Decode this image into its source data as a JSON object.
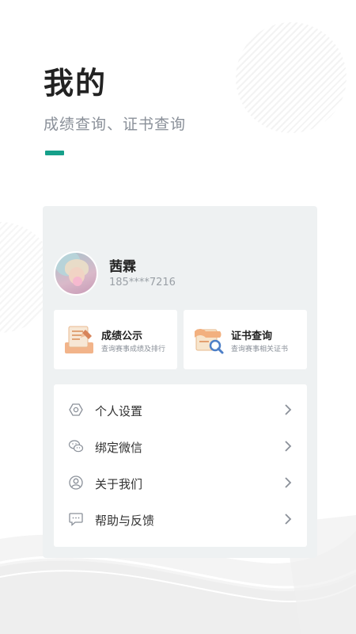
{
  "header": {
    "title": "我的",
    "subtitle": "成绩查询、证书查询",
    "accent_color": "#16a08a"
  },
  "profile": {
    "name": "茜霖",
    "phone": "185****7216",
    "avatar_icon": "avatar-photo"
  },
  "quick_actions": [
    {
      "title": "成绩公示",
      "desc": "查询赛事成绩及排行",
      "icon": "score-board-icon"
    },
    {
      "title": "证书查询",
      "desc": "查询赛事相关证书",
      "icon": "certificate-search-icon"
    }
  ],
  "menu": [
    {
      "label": "个人设置",
      "icon": "settings-icon"
    },
    {
      "label": "绑定微信",
      "icon": "wechat-icon"
    },
    {
      "label": "关于我们",
      "icon": "user-icon"
    },
    {
      "label": "帮助与反馈",
      "icon": "feedback-icon"
    }
  ]
}
